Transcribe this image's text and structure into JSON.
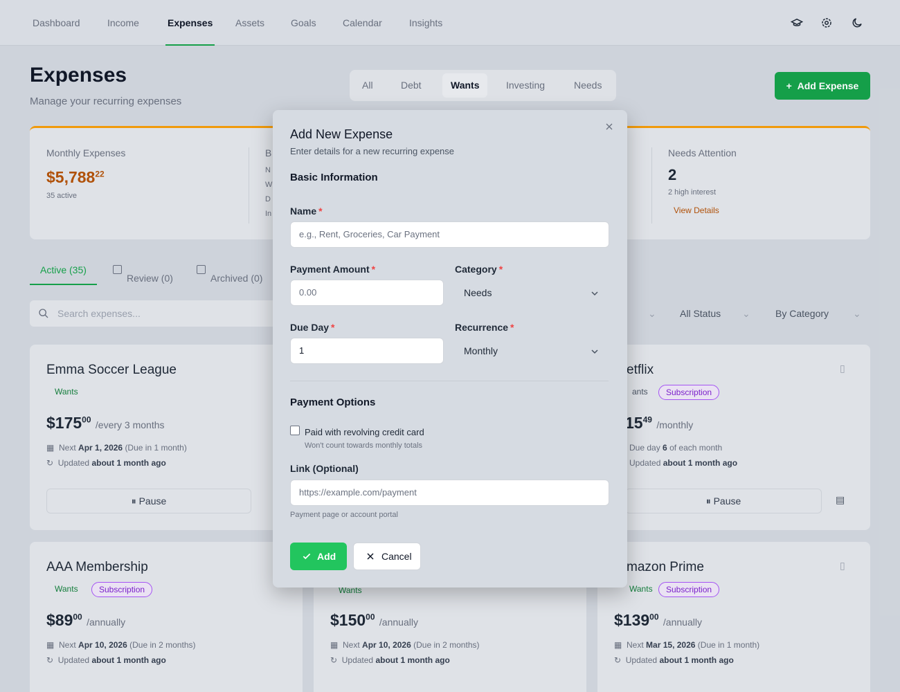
{
  "nav": {
    "items": [
      "Dashboard",
      "Income",
      "Expenses",
      "Assets",
      "Goals",
      "Calendar",
      "Insights"
    ],
    "active": "Expenses",
    "icons": [
      "graduation-cap-icon",
      "gear-icon",
      "moon-icon"
    ]
  },
  "page": {
    "title": "Expenses",
    "subtitle": "Manage your recurring expenses",
    "add_button": "Add Expense"
  },
  "type_filter": {
    "options": [
      "All",
      "Debt",
      "Wants",
      "Investing",
      "Needs"
    ],
    "active": "Wants"
  },
  "stats": {
    "monthly_label": "Monthly Expenses",
    "monthly_dollars": "$5,788",
    "monthly_cents": "22",
    "active_count": "35 active",
    "needs_label": "Needs Attention",
    "needs_count": "2",
    "needs_detail": "2 high interest",
    "needs_link": "View Details",
    "partial_label": "B",
    "partial_lines": [
      "N",
      "W",
      "D",
      "In"
    ]
  },
  "list_tabs": [
    "Active (35)",
    "Review (0)",
    "Archived (0)"
  ],
  "search": {
    "placeholder": "Search expenses..."
  },
  "filters": [
    "All Status",
    "By Category"
  ],
  "cards": [
    {
      "title": "Emma Soccer League",
      "category": "Wants",
      "dollars": "$175",
      "cents": "00",
      "period": "/every 3 months",
      "next_label": "Next",
      "next_date": "Apr 1, 2026",
      "due": "(Due in 1 month)",
      "updated_label": "Updated",
      "updated": "about 1 month ago",
      "action": "Pause"
    },
    {
      "title": "etflix",
      "category": "ants",
      "subscription": "Subscription",
      "dollars": "15",
      "cents": "49",
      "period": "/monthly",
      "due_prefix": "Due day",
      "due_day": "6",
      "due_suffix": "of each month",
      "updated_label": "Updated",
      "updated": "about 1 month ago",
      "action": "Pause"
    },
    {
      "title": "AAA Membership",
      "category": "Wants",
      "subscription": "Subscription",
      "dollars": "$89",
      "cents": "00",
      "period": "/annually",
      "next_label": "Next",
      "next_date": "Apr 10, 2026",
      "due": "(Due in 2 months)",
      "updated_label": "Updated",
      "updated": "about 1 month ago"
    },
    {
      "category": "Wants",
      "dollars": "$150",
      "cents": "00",
      "period": "/annually",
      "next_label": "Next",
      "next_date": "Apr 10, 2026",
      "due": "(Due in 2 months)",
      "updated_label": "Updated",
      "updated": "about 1 month ago"
    },
    {
      "title": "mazon Prime",
      "category": "Wants",
      "subscription": "Subscription",
      "dollars": "$139",
      "cents": "00",
      "period": "/annually",
      "next_label": "Next",
      "next_date": "Mar 15, 2026",
      "due": "(Due in 1 month)",
      "updated_label": "Updated",
      "updated": "about 1 month ago"
    }
  ],
  "modal": {
    "title": "Add New Expense",
    "subtitle": "Enter details for a new recurring expense",
    "section_basic": "Basic Information",
    "name_label": "Name",
    "name_placeholder": "e.g., Rent, Groceries, Car Payment",
    "amount_label": "Payment Amount",
    "amount_placeholder": "0.00",
    "category_label": "Category",
    "category_value": "Needs",
    "due_day_label": "Due Day",
    "due_day_value": "1",
    "recurrence_label": "Recurrence",
    "recurrence_value": "Monthly",
    "section_payment": "Payment Options",
    "revolving_label": "Paid with revolving credit card",
    "revolving_hint": "Won't count towards monthly totals",
    "link_label": "Link (Optional)",
    "link_placeholder": "https://example.com/payment",
    "link_hint": "Payment page or account portal",
    "required_mark": "*",
    "add_button": "Add",
    "cancel_button": "Cancel"
  },
  "colors": {
    "accent": "#22c55e",
    "brand_green": "#16a34a",
    "required": "#ef4444",
    "warning_bar": "#f59e0b",
    "subscription": "#7e22ce"
  }
}
